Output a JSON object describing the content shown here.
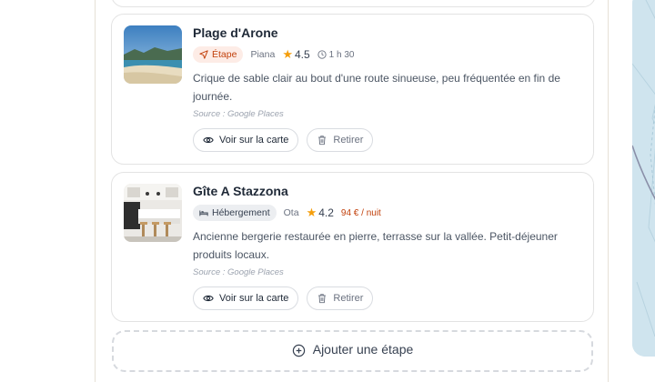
{
  "places": [
    {
      "title": "Plage d'Arone",
      "tag": "Étape",
      "location": "Piana",
      "rating": "4.5",
      "duration": "1 h 30",
      "description": "Crique de sable clair au bout d'une route sinueuse, peu fréquentée en fin de journée.",
      "source": "Source : Google Places",
      "view_label": "Voir sur la carte",
      "remove_label": "Retirer"
    },
    {
      "title": "Gîte A Stazzona",
      "tag": "Hébergement",
      "location": "Ota",
      "rating": "4.2",
      "price": "94 € / nuit",
      "description": "Ancienne bergerie restaurée en pierre, terrasse sur la vallée. Petit-déjeuner produits locaux.",
      "source": "Source : Google Places",
      "view_label": "Voir sur la carte",
      "remove_label": "Retirer"
    }
  ],
  "add_step_label": "Ajouter une étape",
  "colors": {
    "accent": "#c2410c",
    "star": "#f59e0b",
    "map_water": "#cfe4ee"
  },
  "icons": [
    "navigation-icon",
    "star-icon",
    "clock-icon",
    "bed-icon",
    "eye-icon",
    "trash-icon",
    "plus-circle-icon"
  ]
}
